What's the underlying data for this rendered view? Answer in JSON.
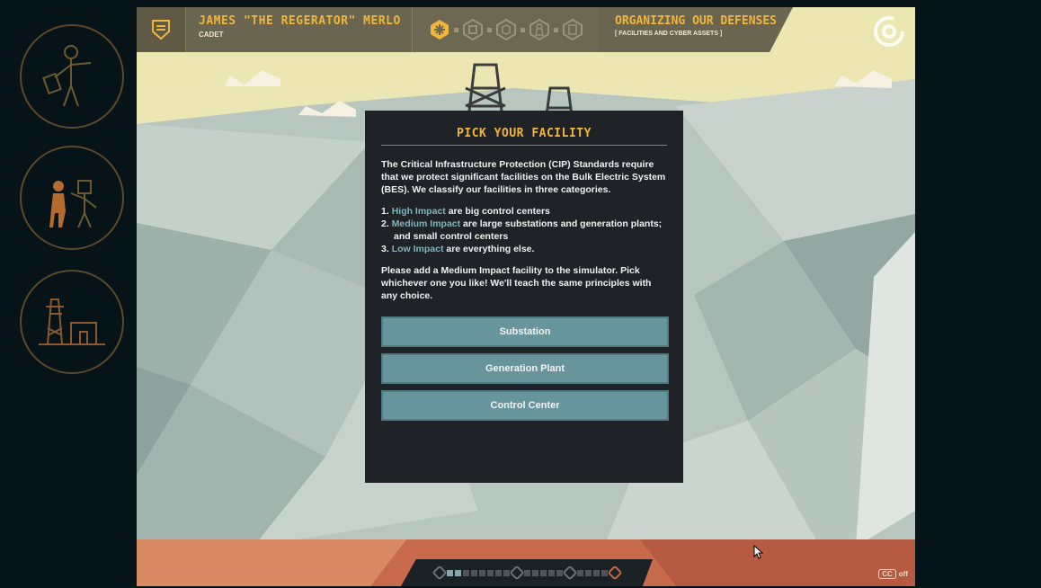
{
  "header": {
    "player_name": "JAMES \"THE REGERATOR\" MERLO",
    "player_rank": "CADET",
    "section_title": "ORGANIZING OUR DEFENSES",
    "section_subtitle": "[ FACILITIES AND CYBER ASSETS ]",
    "steps": [
      "alert-icon",
      "chip-icon",
      "cube-icon",
      "tower-icon",
      "document-icon"
    ]
  },
  "dialog": {
    "title": "PICK YOUR FACILITY",
    "intro_lead": "The Critical Infrastructure Protection (CIP) Standards require that we protect significant facilities on the",
    "intro_bes": "Bulk Electric System (BES). We classify our facilities in three categories.",
    "list": [
      {
        "num": "1.",
        "term": "High Impact",
        "desc": " are big control centers"
      },
      {
        "num": "2.",
        "term": "Medium Impact",
        "desc": " are large substations and generation plants; and small control centers"
      },
      {
        "num": "3.",
        "term": "Low Impact",
        "desc": " are everything else."
      }
    ],
    "closing": "Please add a Medium Impact facility to the simulator. Pick whichever one you like! We'll teach the same principles with any choice.",
    "choices": [
      "Substation",
      "Generation Plant",
      "Control Center"
    ]
  },
  "footer": {
    "cc_label": "CC",
    "cc_state": "off"
  },
  "colors": {
    "accent": "#f2b53b",
    "highlight": "#7bb7c0",
    "button": "#67959b",
    "dialog_bg": "#1f2327"
  }
}
